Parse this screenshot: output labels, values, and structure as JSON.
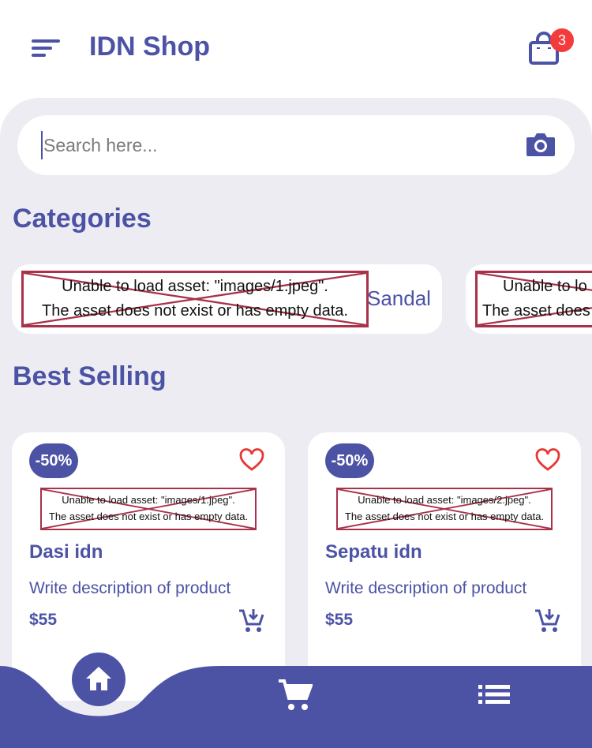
{
  "app": {
    "title": "IDN Shop",
    "cart_count": "3"
  },
  "search": {
    "placeholder": "Search here..."
  },
  "sections": {
    "categories": "Categories",
    "best_selling": "Best Selling"
  },
  "categories": [
    {
      "error_line1": "Unable to load asset: \"images/1.jpeg\".",
      "error_line2": "The asset does not exist or has empty data.",
      "label": "Sandal"
    },
    {
      "error_line1": "Unable to lo",
      "error_line2": "The asset does"
    }
  ],
  "products": [
    {
      "discount": "-50%",
      "error_line1": "Unable to load asset: \"images/1.jpeg\".",
      "error_line2": "The asset does not exist or has empty data.",
      "name": "Dasi idn",
      "description": "Write description of product",
      "price": "$55"
    },
    {
      "discount": "-50%",
      "error_line1": "Unable to load asset: \"images/2.jpeg\".",
      "error_line2": "The asset does not exist or has empty data.",
      "name": "Sepatu idn",
      "description": "Write description of product",
      "price": "$55"
    }
  ],
  "nav": {
    "items": [
      "home-icon",
      "cart-icon",
      "list-icon"
    ],
    "active": "home"
  },
  "colors": {
    "primary": "#4c53a5",
    "background": "#edecf2",
    "badge": "#f33b3b",
    "heart": "#e53935",
    "error_border": "#a8324a"
  }
}
